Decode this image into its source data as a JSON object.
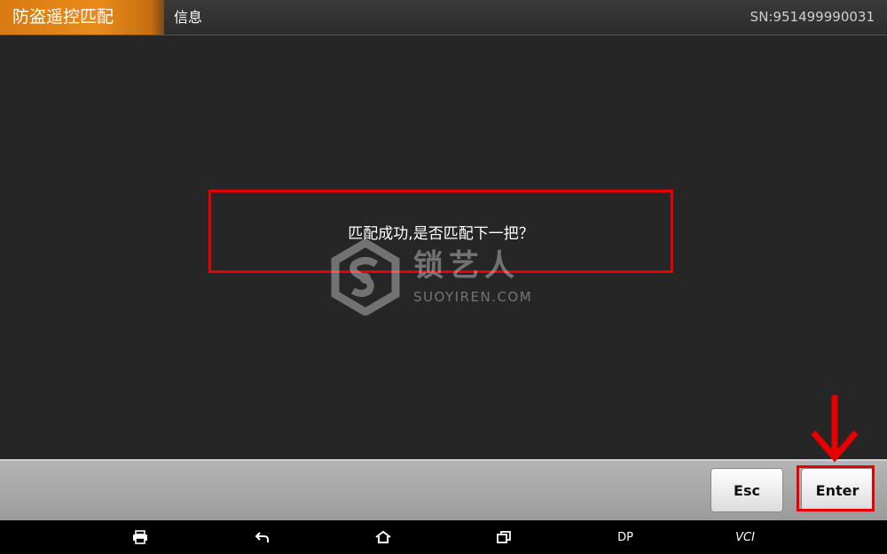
{
  "header": {
    "app_title": "防盗遥控匹配",
    "section_title": "信息",
    "serial": "SN:951499990031"
  },
  "dialog": {
    "message": "匹配成功,是否匹配下一把？"
  },
  "watermark": {
    "text": "锁艺人",
    "subtext": "SUOYIREN.COM"
  },
  "actions": {
    "esc_label": "Esc",
    "enter_label": "Enter"
  },
  "system_bar": {
    "icons": [
      "printer-icon",
      "back-icon",
      "home-icon",
      "recent-apps-icon"
    ],
    "dp_label": "DP",
    "vci_label": "VCI"
  },
  "colors": {
    "accent_orange": "#e98a1a",
    "highlight_red": "#e60000",
    "background": "#262626"
  }
}
